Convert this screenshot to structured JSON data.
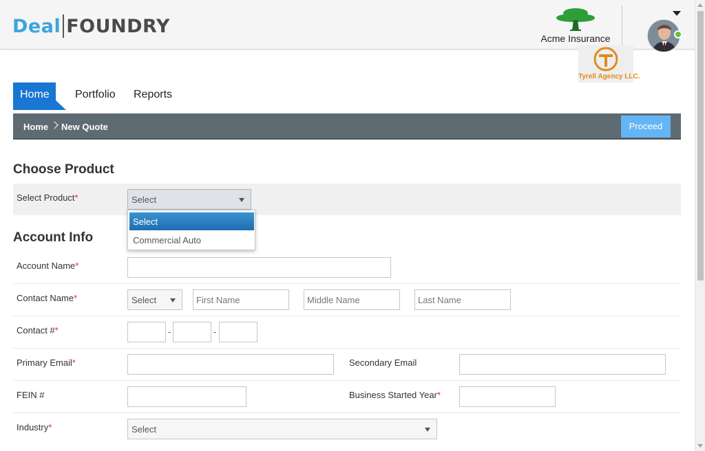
{
  "brand": {
    "deal": "Deal",
    "foundry": "FOUNDRY"
  },
  "carrier": {
    "name": "Acme Insurance",
    "icon": "tree-icon"
  },
  "agency": {
    "name": "Tyrell Agency LLC.",
    "icon": "t-logo-icon"
  },
  "user": {
    "avatar": "avatar",
    "status": "online"
  },
  "nav": {
    "tabs": [
      {
        "label": "Home",
        "active": true
      },
      {
        "label": "Portfolio"
      },
      {
        "label": "Reports"
      }
    ]
  },
  "breadcrumb": {
    "items": [
      "Home",
      "New Quote"
    ]
  },
  "actions": {
    "proceed": "Proceed"
  },
  "sections": {
    "choose_product": "Choose Product",
    "account_info": "Account Info"
  },
  "product": {
    "label": "Select Product",
    "value": "Select",
    "options": [
      "Select",
      "Commercial Auto"
    ],
    "selected_option": "Select"
  },
  "account": {
    "account_name_label": "Account Name",
    "contact_name_label": "Contact Name",
    "contact_salutation": "Select",
    "first_name_placeholder": "First Name",
    "middle_name_placeholder": "Middle Name",
    "last_name_placeholder": "Last Name",
    "contact_number_label": "Contact #",
    "phone_separator": "-",
    "primary_email_label": "Primary Email",
    "secondary_email_label": "Secondary Email",
    "fein_label": "FEIN #",
    "business_started_label": "Business Started Year",
    "industry_label": "Industry",
    "industry_value": "Select",
    "required_marker": "*"
  },
  "colors": {
    "accent": "#1976d2",
    "brand_blue": "#3aa6dd",
    "crumb_bar": "#5f6b73",
    "proceed": "#64b5f6",
    "required": "#d32f2f"
  }
}
